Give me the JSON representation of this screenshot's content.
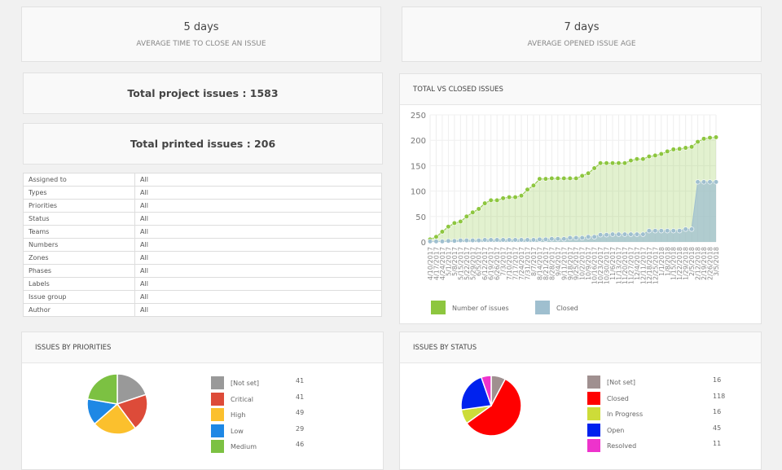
{
  "stats": [
    {
      "value": "5 days",
      "label": "AVERAGE TIME TO CLOSE AN ISSUE"
    },
    {
      "value": "7 days",
      "label": "AVERAGE OPENED ISSUE AGE"
    }
  ],
  "totals": {
    "project": "Total project issues : 1583",
    "printed": "Total printed issues : 206"
  },
  "filters": [
    [
      "Assigned to",
      "All"
    ],
    [
      "Types",
      "All"
    ],
    [
      "Priorities",
      "All"
    ],
    [
      "Status",
      "All"
    ],
    [
      "Teams",
      "All"
    ],
    [
      "Numbers",
      "All"
    ],
    [
      "Zones",
      "All"
    ],
    [
      "Phases",
      "All"
    ],
    [
      "Labels",
      "All"
    ],
    [
      "Issue group",
      "All"
    ],
    [
      "Author",
      "All"
    ]
  ],
  "chart_data": [
    {
      "type": "area",
      "title": "TOTAL VS CLOSED ISSUES",
      "ylim": [
        0,
        250
      ],
      "yticks": [
        0,
        50,
        100,
        150,
        200,
        250
      ],
      "grid": true,
      "legend": "bottom-left",
      "x": [
        "4/10/2017",
        "4/17/2017",
        "4/24/2017",
        "5/1/2017",
        "5/8/2017",
        "5/15/2017",
        "5/22/2017",
        "5/29/2017",
        "6/5/2017",
        "6/12/2017",
        "6/19/2017",
        "6/26/2017",
        "7/3/2017",
        "7/10/2017",
        "7/17/2017",
        "7/24/2017",
        "7/31/2017",
        "8/7/2017",
        "8/14/2017",
        "8/21/2017",
        "8/28/2017",
        "9/4/2017",
        "9/11/2017",
        "9/18/2017",
        "9/25/2017",
        "10/2/2017",
        "10/9/2017",
        "10/16/2017",
        "10/23/2017",
        "10/30/2017",
        "11/6/2017",
        "11/13/2017",
        "11/20/2017",
        "11/27/2017",
        "12/4/2017",
        "12/11/2017",
        "12/18/2017",
        "12/25/2017",
        "1/1/2018",
        "1/8/2018",
        "1/15/2018",
        "1/22/2018",
        "1/29/2018",
        "2/5/2018",
        "2/12/2018",
        "2/19/2018",
        "2/26/2018",
        "3/5/2018"
      ],
      "series": [
        {
          "name": "Number of issues",
          "color": "#8dc63f",
          "values": [
            5,
            10,
            20,
            30,
            37,
            40,
            50,
            58,
            65,
            76,
            82,
            82,
            86,
            88,
            88,
            91,
            103,
            111,
            124,
            124,
            125,
            125,
            125,
            125,
            125,
            130,
            135,
            145,
            155,
            155,
            155,
            155,
            155,
            160,
            163,
            163,
            168,
            170,
            173,
            178,
            182,
            183,
            185,
            187,
            197,
            203,
            205,
            206
          ]
        },
        {
          "name": "Closed",
          "color": "#9fbfcf",
          "values": [
            1,
            1,
            1,
            2,
            2,
            3,
            3,
            3,
            3,
            4,
            4,
            4,
            4,
            4,
            4,
            4,
            4,
            4,
            5,
            5,
            6,
            6,
            6,
            8,
            8,
            8,
            10,
            10,
            14,
            14,
            15,
            15,
            15,
            15,
            15,
            15,
            22,
            22,
            22,
            22,
            22,
            22,
            25,
            25,
            118,
            118,
            118,
            118
          ]
        }
      ]
    },
    {
      "type": "pie",
      "title": "ISSUES BY PRIORITIES",
      "slices": [
        {
          "label": "[Not set]",
          "value": 41,
          "color": "#999999"
        },
        {
          "label": "Critical",
          "value": 41,
          "color": "#dd4b39"
        },
        {
          "label": "High",
          "value": 49,
          "color": "#fbc02d"
        },
        {
          "label": "Low",
          "value": 29,
          "color": "#1e88e5"
        },
        {
          "label": "Medium",
          "value": 46,
          "color": "#7cc142"
        }
      ]
    },
    {
      "type": "pie",
      "title": "ISSUES BY STATUS",
      "slices": [
        {
          "label": "[Not set]",
          "value": 16,
          "color": "#a09090"
        },
        {
          "label": "Closed",
          "value": 118,
          "color": "#ff0000"
        },
        {
          "label": "In Progress",
          "value": 16,
          "color": "#cddc39"
        },
        {
          "label": "Open",
          "value": 45,
          "color": "#0022ee"
        },
        {
          "label": "Resolved",
          "value": 11,
          "color": "#ee33cc"
        }
      ]
    }
  ]
}
